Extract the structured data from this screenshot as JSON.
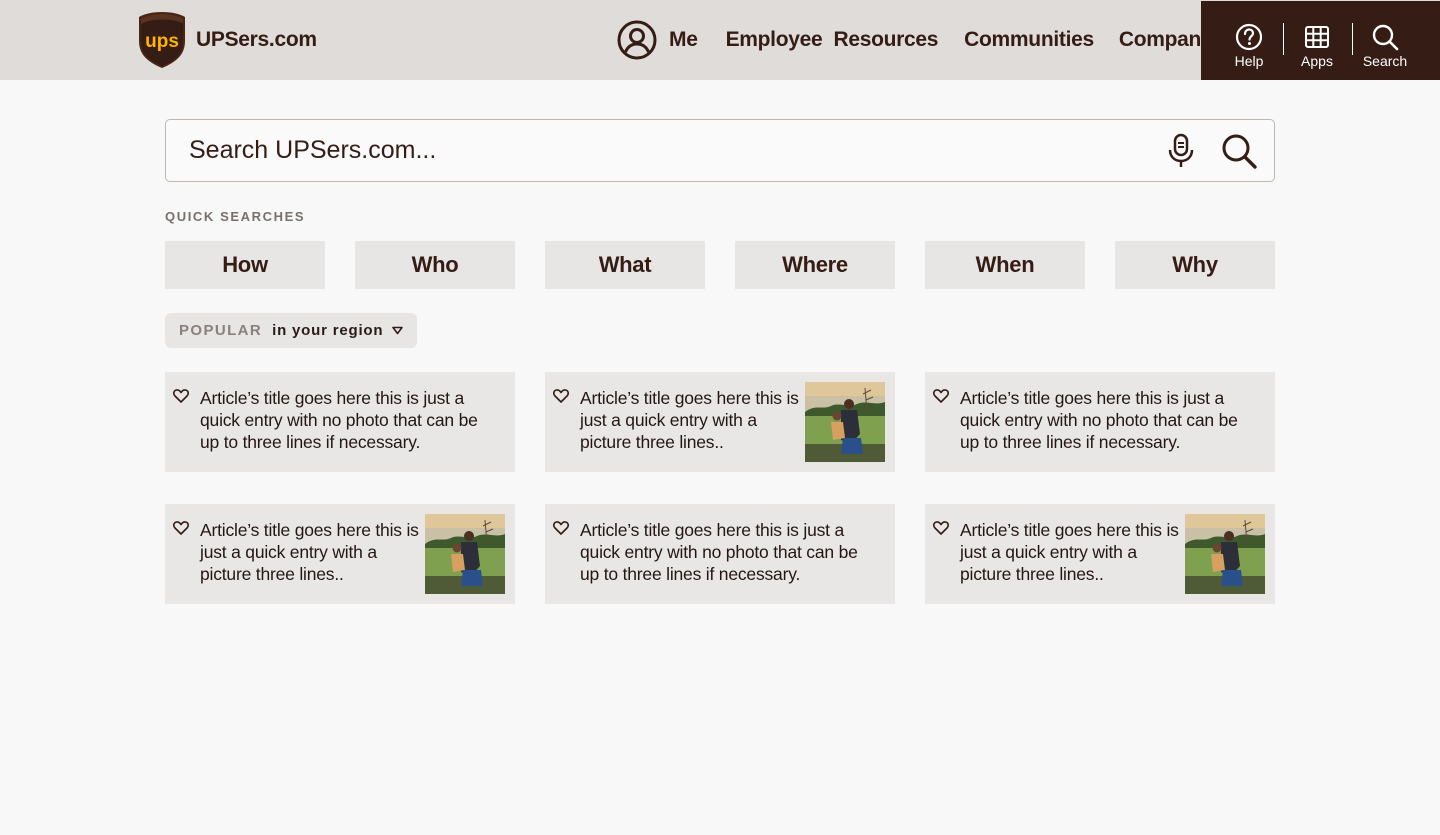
{
  "header": {
    "brand_text": "UPSers.com",
    "logo_label": "ups",
    "nav": {
      "me": "Me",
      "employee_resources": "Employee  Resources",
      "communities": "Communities",
      "company": "Company"
    },
    "utility": {
      "help": "Help",
      "apps": "Apps",
      "search": "Search"
    }
  },
  "search": {
    "placeholder": "Search UPSers.com..."
  },
  "quick_searches": {
    "label": "QUICK SEARCHES",
    "items": [
      "How",
      "Who",
      "What",
      "Where",
      "When",
      "Why"
    ]
  },
  "popular": {
    "label": "POPULAR",
    "region": "in your region"
  },
  "articles": [
    {
      "title": "Article’s title goes here this is just a quick entry with no photo that can be up to three lines if necessary."
    },
    {
      "title": "Article’s title goes here this is just a quick entry with a picture three lines.."
    },
    {
      "title": "Article’s title goes here this is just a quick entry with no photo that can be up to three lines if necessary."
    },
    {
      "title": "Article’s title goes here this is just a quick entry with a picture three lines.."
    },
    {
      "title": "Article’s title goes here this is just a quick entry with no photo that can be up to three lines if necessary."
    },
    {
      "title": "Article’s title goes here this is just a quick entry with a picture three lines.."
    }
  ],
  "colors": {
    "brand_brown": "#351c15",
    "brand_gold": "#ffb500",
    "header_bg": "#dfdcd9",
    "card_bg": "#e8e7e6"
  }
}
